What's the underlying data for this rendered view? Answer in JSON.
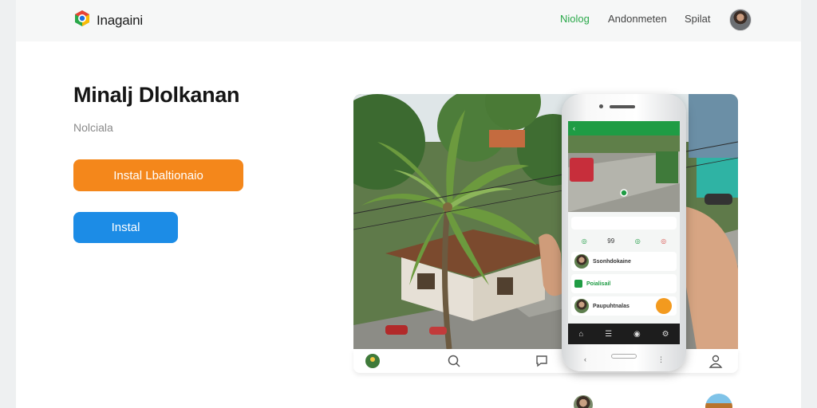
{
  "header": {
    "brand": "Inagaini",
    "nav": [
      {
        "label": "Niolog",
        "active": true
      },
      {
        "label": "Andonmeten",
        "active": false
      },
      {
        "label": "Spilat",
        "active": false
      }
    ]
  },
  "main": {
    "title": "Minalj Dlolkanan",
    "subtitle": "Nolciala",
    "primary_button": "Instal Lbaltionaio",
    "secondary_button": "Instal"
  },
  "phone": {
    "stats": [
      "◎",
      "99",
      "◎",
      "◎"
    ],
    "rows": [
      {
        "label": "Ssonhdokaine",
        "style": "avatar"
      },
      {
        "label": "Poialisail",
        "style": "green"
      },
      {
        "label": "Paupuhtnalas",
        "style": "avatar"
      }
    ]
  },
  "colors": {
    "brand_green": "#2aa84a",
    "orange": "#f4871b",
    "blue": "#1c8ce6",
    "app_green": "#1f9c44"
  },
  "icons": [
    "brand-logo-icon",
    "search-icon",
    "chat-icon",
    "user-icon",
    "back-icon",
    "location-pin-icon"
  ]
}
